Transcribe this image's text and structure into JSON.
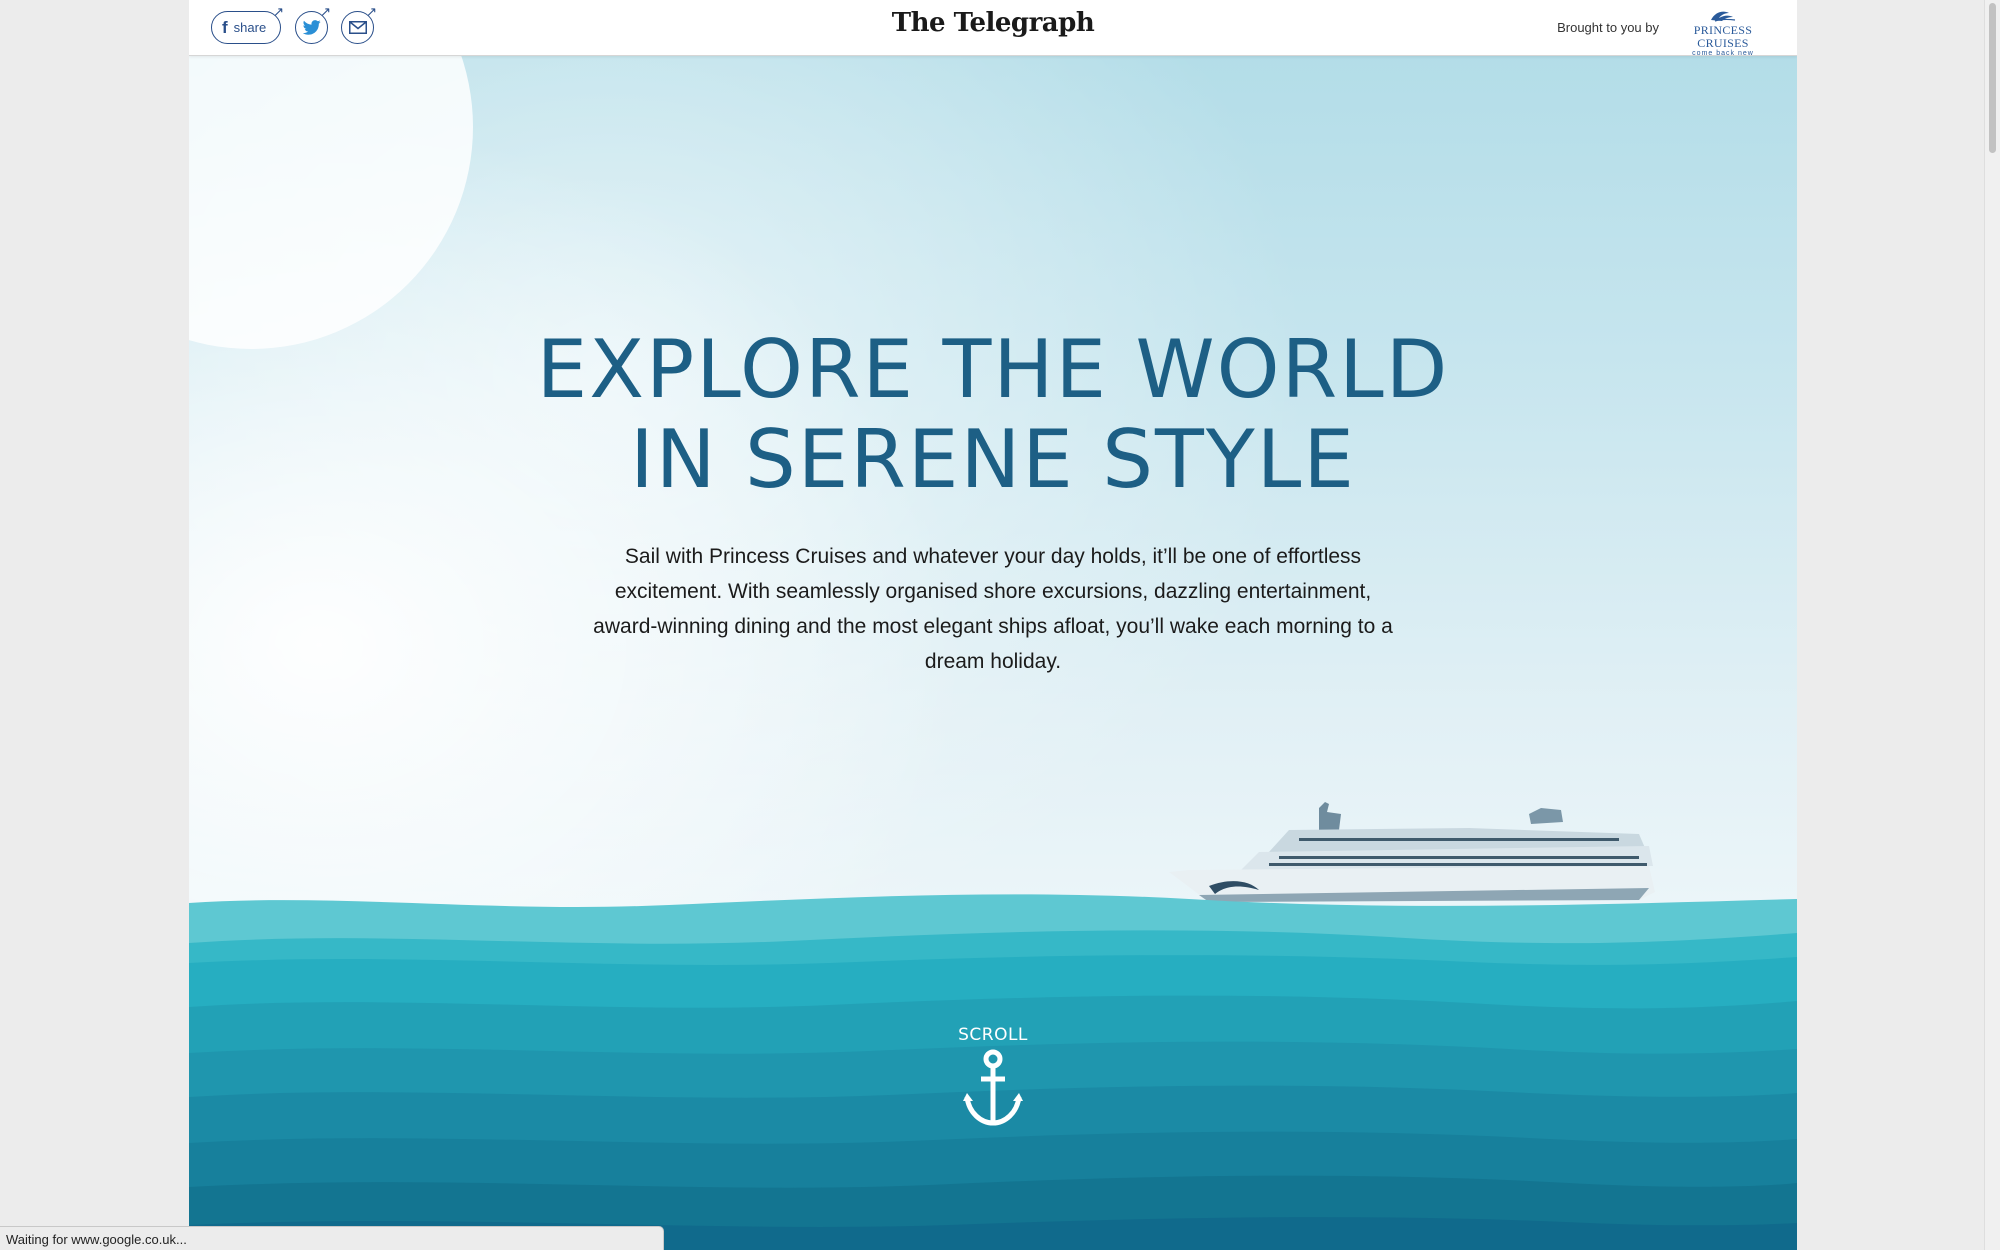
{
  "header": {
    "share_label": "share",
    "share_arrow": "↗",
    "masthead": "The Telegraph",
    "brought_by": "Brought to you by",
    "sponsor_name": "PRINCESS CRUISES",
    "sponsor_tagline": "come back new"
  },
  "hero": {
    "title_line1": "EXPLORE THE WORLD",
    "title_line2": "IN SERENE STYLE",
    "body": "Sail with Princess Cruises and whatever your day holds, it’ll be one of effortless excitement. With seamlessly organised shore excursions, dazzling entertainment, award-winning dining and the most elegant ships afloat, you’ll wake each morning to a dream holiday.",
    "scroll_label": "SCROLL"
  },
  "browser": {
    "status_text": "Waiting for www.google.co.uk..."
  },
  "icons": {
    "facebook": "facebook-icon",
    "twitter": "twitter-icon",
    "email": "email-icon",
    "anchor": "anchor-icon",
    "sponsor_logo": "princess-cruises-logo"
  },
  "colors": {
    "title_blue": "#1d5f85",
    "share_blue": "#2a4f8a",
    "sky_top": "#b3dde8",
    "sea_light": "#5ec8d2",
    "sea_dark": "#106a8c"
  }
}
